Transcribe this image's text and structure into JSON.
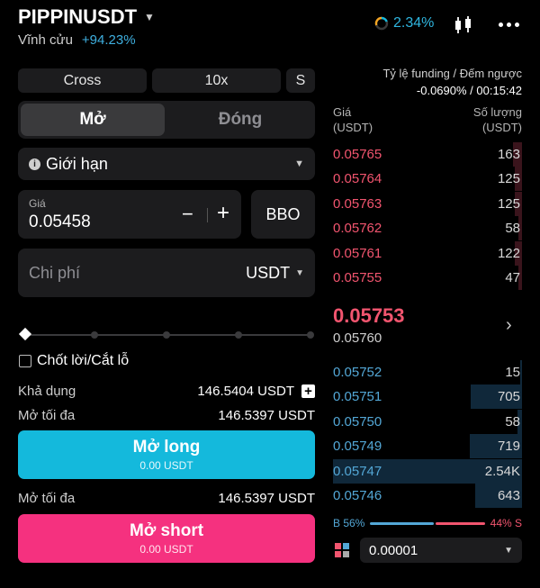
{
  "header": {
    "symbol": "PIPPINUSDT",
    "contract_type": "Vĩnh cửu",
    "change": "+94.23%",
    "funding_pct": "2.34%"
  },
  "order_form": {
    "margin_mode": "Cross",
    "leverage": "10x",
    "mode_s": "S",
    "tab_open": "Mở",
    "tab_close": "Đóng",
    "order_type": "Giới hạn",
    "price_label": "Giá",
    "price_value": "0.05458",
    "minus": "−",
    "plus": "+",
    "bbo": "BBO",
    "cost_placeholder": "Chi phí",
    "cost_unit": "USDT",
    "tp_sl_label": "Chốt lời/Cắt lỗ",
    "available_label": "Khả dụng",
    "available_value": "146.5404 USDT",
    "max_open_label": "Mở tối đa",
    "max_open_long": "146.5397 USDT",
    "long_button": "Mở long",
    "long_sub": "0.00 USDT",
    "max_open_label_2": "Mở tối đa",
    "max_open_short": "146.5397 USDT",
    "short_button": "Mở short",
    "short_sub": "0.00 USDT"
  },
  "orderbook": {
    "funding_label": "Tỷ lệ funding / Đếm ngược",
    "funding_value": "-0.0690% / 00:15:42",
    "price_header": "Giá",
    "price_unit": "(USDT)",
    "qty_header": "Số lượng",
    "qty_unit": "(USDT)",
    "asks": [
      {
        "price": "0.05765",
        "qty": "163"
      },
      {
        "price": "0.05764",
        "qty": "125"
      },
      {
        "price": "0.05763",
        "qty": "125"
      },
      {
        "price": "0.05762",
        "qty": "58"
      },
      {
        "price": "0.05761",
        "qty": "122"
      },
      {
        "price": "0.05755",
        "qty": "47"
      }
    ],
    "last_price": "0.05753",
    "mark_price": "0.05760",
    "bids": [
      {
        "price": "0.05752",
        "qty": "15"
      },
      {
        "price": "0.05751",
        "qty": "705"
      },
      {
        "price": "0.05750",
        "qty": "58"
      },
      {
        "price": "0.05749",
        "qty": "719"
      },
      {
        "price": "0.05747",
        "qty": "2.54K"
      },
      {
        "price": "0.05746",
        "qty": "643"
      }
    ],
    "buy_ratio": "B 56%",
    "sell_ratio": "44% S",
    "buy_fraction": 0.56,
    "precision": "0.00001"
  },
  "colors": {
    "long": "#14b9dc",
    "short": "#f5317f",
    "ask_text": "#f2556f",
    "bid_text": "#53a7d6"
  }
}
